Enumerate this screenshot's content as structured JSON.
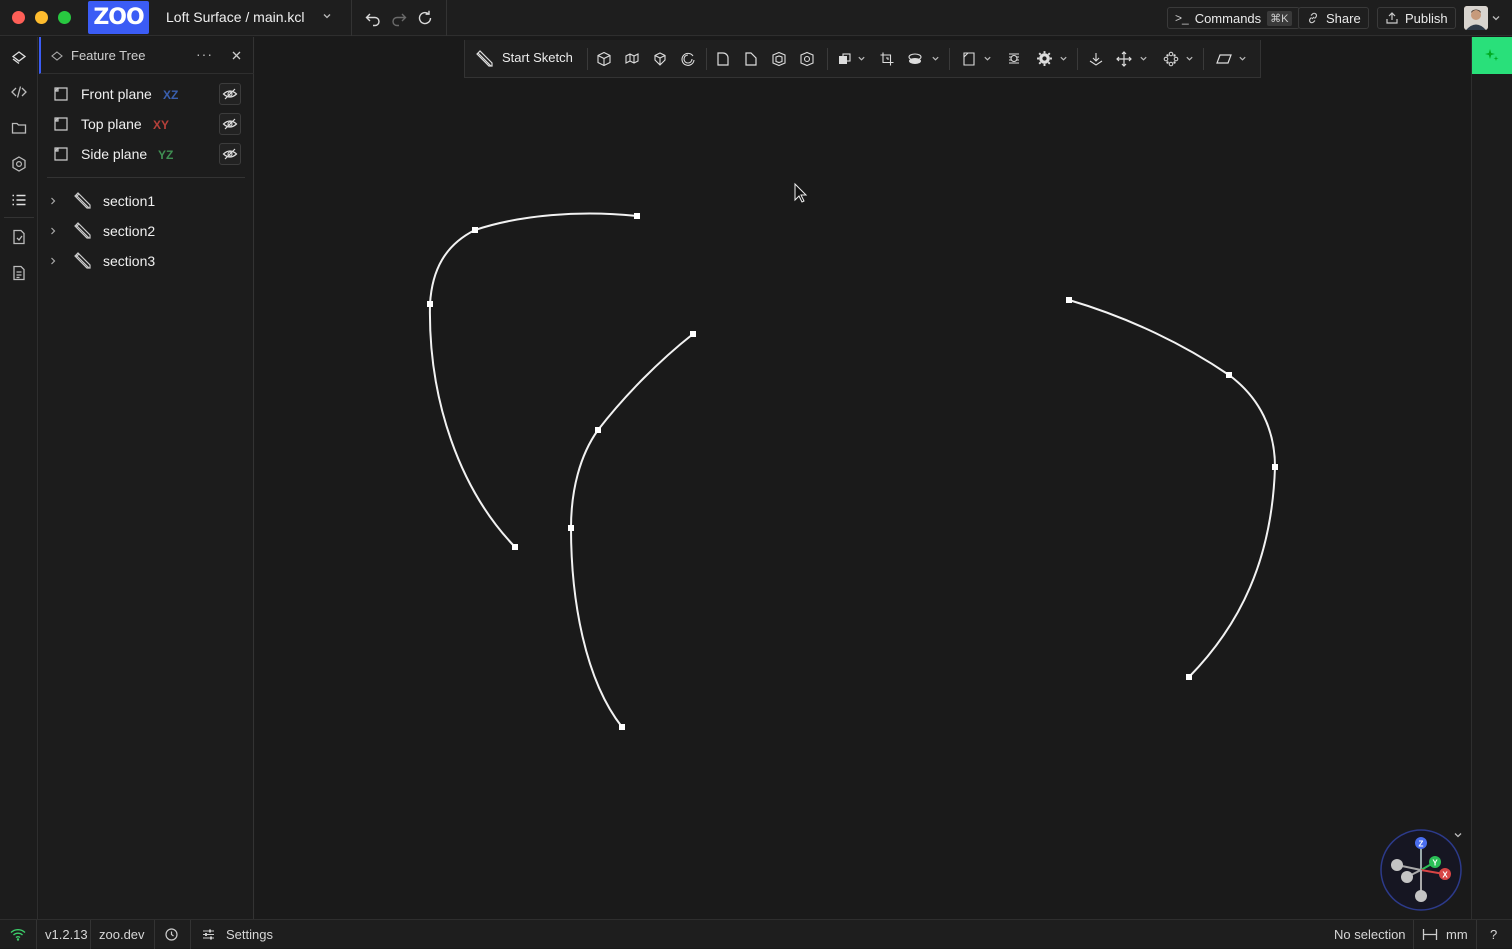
{
  "titlebar": {
    "logo": "ZOO",
    "project_title": "Loft Surface / main.kcl",
    "commands_label": "Commands",
    "commands_shortcut": "⌘K",
    "share_label": "Share",
    "publish_label": "Publish"
  },
  "feature_tree": {
    "title": "Feature Tree",
    "planes": [
      {
        "label": "Front plane",
        "axis": "XZ",
        "color": "#3a5fae"
      },
      {
        "label": "Top plane",
        "axis": "XY",
        "color": "#b5403a"
      },
      {
        "label": "Side plane",
        "axis": "YZ",
        "color": "#3f8f52"
      }
    ],
    "sections": [
      {
        "label": "section1"
      },
      {
        "label": "section2"
      },
      {
        "label": "section3"
      }
    ]
  },
  "toolbar": {
    "start_sketch_label": "Start Sketch"
  },
  "statusbar": {
    "version": "v1.2.13",
    "site": "zoo.dev",
    "settings_label": "Settings",
    "selection": "No selection",
    "units": "mm",
    "help": "?"
  },
  "gizmo": {
    "z": "Z",
    "y": "Y",
    "x": "X"
  },
  "colors": {
    "brand": "#3b5cf5",
    "accent_green": "#29e07a",
    "curve": "#f2f2f2"
  }
}
